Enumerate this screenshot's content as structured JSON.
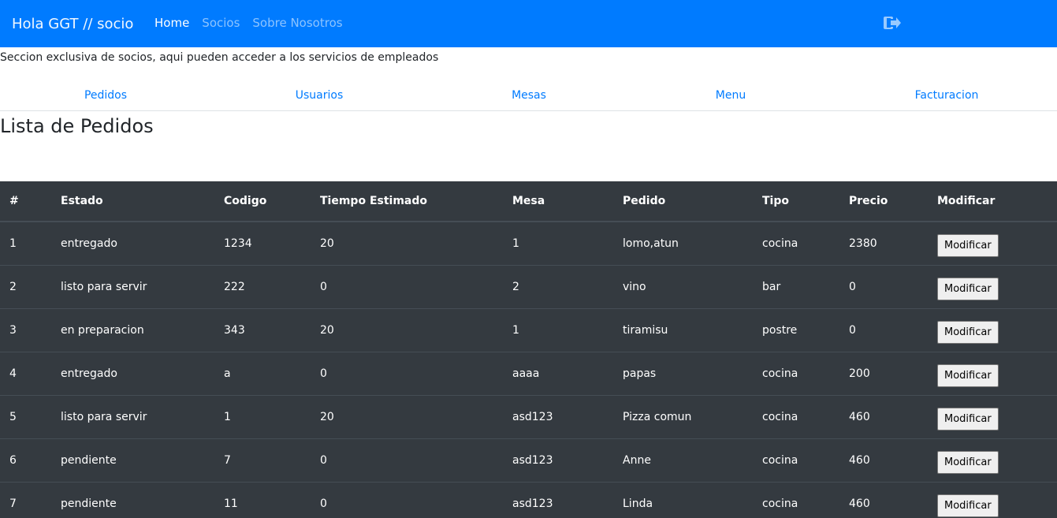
{
  "navbar": {
    "brand": "Hola GGT // socio",
    "links": [
      {
        "label": "Home",
        "active": true
      },
      {
        "label": "Socios",
        "active": false
      },
      {
        "label": "Sobre Nosotros",
        "active": false
      }
    ],
    "logout_icon": "sign-out-icon",
    "color": "#007bff"
  },
  "intro": "Seccion exclusiva de socios, aqui pueden acceder a los servicios de empleados",
  "subnav": {
    "items": [
      "Pedidos",
      "Usuarios",
      "Mesas",
      "Menu",
      "Facturacion"
    ]
  },
  "page_title": "Lista de Pedidos",
  "table": {
    "headers": [
      "#",
      "Estado",
      "Codigo",
      "Tiempo Estimado",
      "Mesa",
      "Pedido",
      "Tipo",
      "Precio",
      "Modificar"
    ],
    "button_label": "Modificar",
    "rows": [
      {
        "n": "1",
        "estado": "entregado",
        "codigo": "1234",
        "tiempo": "20",
        "mesa": "1",
        "pedido": "lomo,atun",
        "tipo": "cocina",
        "precio": "2380"
      },
      {
        "n": "2",
        "estado": "listo para servir",
        "codigo": "222",
        "tiempo": "0",
        "mesa": "2",
        "pedido": "vino",
        "tipo": "bar",
        "precio": "0"
      },
      {
        "n": "3",
        "estado": "en preparacion",
        "codigo": "343",
        "tiempo": "20",
        "mesa": "1",
        "pedido": "tiramisu",
        "tipo": "postre",
        "precio": "0"
      },
      {
        "n": "4",
        "estado": "entregado",
        "codigo": "a",
        "tiempo": "0",
        "mesa": "aaaa",
        "pedido": "papas",
        "tipo": "cocina",
        "precio": "200"
      },
      {
        "n": "5",
        "estado": "listo para servir",
        "codigo": "1",
        "tiempo": "20",
        "mesa": "asd123",
        "pedido": "Pizza comun",
        "tipo": "cocina",
        "precio": "460"
      },
      {
        "n": "6",
        "estado": "pendiente",
        "codigo": "7",
        "tiempo": "0",
        "mesa": "asd123",
        "pedido": "Anne",
        "tipo": "cocina",
        "precio": "460"
      },
      {
        "n": "7",
        "estado": "pendiente",
        "codigo": "11",
        "tiempo": "0",
        "mesa": "asd123",
        "pedido": "Linda",
        "tipo": "cocina",
        "precio": "460"
      }
    ]
  }
}
